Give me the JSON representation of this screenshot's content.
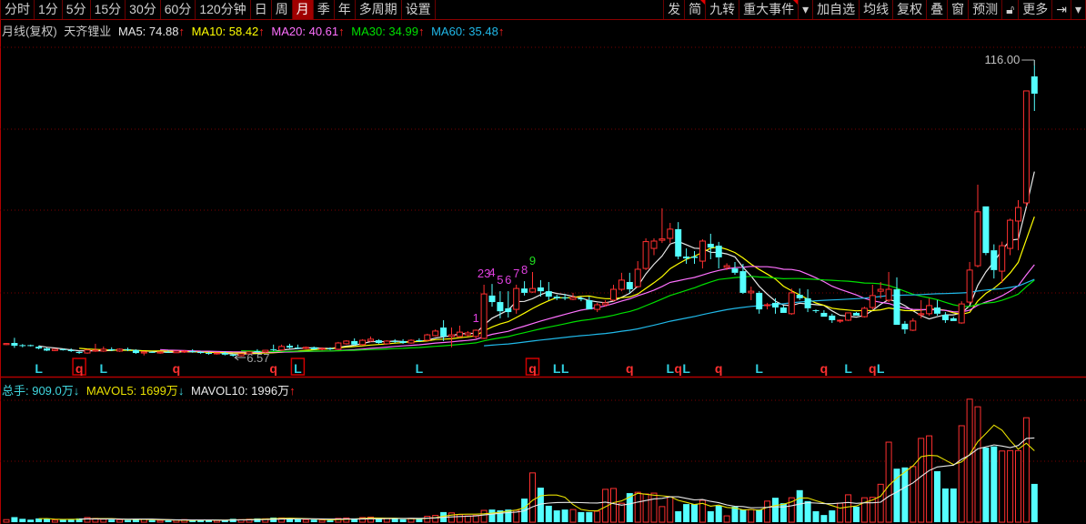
{
  "toolbar": {
    "left": [
      {
        "label": "分时"
      },
      {
        "label": "1分"
      },
      {
        "label": "5分"
      },
      {
        "label": "15分"
      },
      {
        "label": "30分"
      },
      {
        "label": "60分"
      },
      {
        "label": "120分钟"
      },
      {
        "label": "日"
      },
      {
        "label": "周"
      },
      {
        "label": "月",
        "active": true
      },
      {
        "label": "季"
      },
      {
        "label": "年"
      },
      {
        "label": "多周期"
      },
      {
        "label": "设置"
      }
    ],
    "right": [
      {
        "label": "发"
      },
      {
        "label": "简",
        "flag": true
      },
      {
        "label": "九转"
      },
      {
        "label": "重大事件",
        "flag": true
      },
      {
        "label": "▾",
        "icon": "dropdown-icon"
      },
      {
        "label": "加自选"
      },
      {
        "label": "均线"
      },
      {
        "label": "复权"
      },
      {
        "label": "叠"
      },
      {
        "label": "窗"
      },
      {
        "label": "预测"
      },
      {
        "label": "🔓︎",
        "icon": "lock-icon"
      },
      {
        "label": "更多"
      },
      {
        "label": "⇥",
        "icon": "collapse-panel-icon"
      },
      {
        "label": "▾",
        "icon": "dropdown-icon"
      }
    ]
  },
  "legend": {
    "period": "月线(复权)",
    "stock_name": "天齐锂业",
    "ma5": "MA5: 74.88",
    "ma10": "MA10: 58.42",
    "ma20": "MA20: 40.61",
    "ma30": "MA30: 34.99",
    "ma60": "MA60: 35.48",
    "up_arrow": "↑",
    "down_arrow": "↓"
  },
  "vol_legend": {
    "total": "总手: 909.0万",
    "mavol5": "MAVOL5: 1699万",
    "mavol10": "MAVOL10: 1996万"
  },
  "colors": {
    "up": "#ff3030",
    "down": "#54ffff",
    "ma5": "#e8e8e8",
    "ma10": "#ffff00",
    "ma20": "#ff70ff",
    "ma30": "#00e000",
    "ma60": "#20b8e8",
    "grid": "#7a0000",
    "border": "#b00000"
  },
  "chart_data": {
    "type": "candlestick",
    "period": "monthly",
    "annotations": {
      "high_label": "116.00",
      "low_label": "6.57"
    },
    "ohlc": [
      [
        11.0,
        11.6,
        10.8,
        11.4
      ],
      [
        11.6,
        13.5,
        9.8,
        10.6
      ],
      [
        10.8,
        11.2,
        10.0,
        10.6
      ],
      [
        10.8,
        11.0,
        10.3,
        10.5
      ],
      [
        10.2,
        10.6,
        9.3,
        9.6
      ],
      [
        9.6,
        9.9,
        8.6,
        8.8
      ],
      [
        8.8,
        9.3,
        8.6,
        9.3
      ],
      [
        9.3,
        9.6,
        8.8,
        9.0
      ],
      [
        9.0,
        9.6,
        8.3,
        8.6
      ],
      [
        8.3,
        8.6,
        7.6,
        7.9
      ],
      [
        7.9,
        9.3,
        7.6,
        9.0
      ],
      [
        8.6,
        11.3,
        8.3,
        9.0
      ],
      [
        8.6,
        10.3,
        8.3,
        9.3
      ],
      [
        9.3,
        10.0,
        8.6,
        8.9
      ],
      [
        8.6,
        9.6,
        8.3,
        9.3
      ],
      [
        9.3,
        9.9,
        8.6,
        9.0
      ],
      [
        9.0,
        9.3,
        7.6,
        7.9
      ],
      [
        7.9,
        8.6,
        7.0,
        8.3
      ],
      [
        8.3,
        8.6,
        7.9,
        8.0
      ],
      [
        7.9,
        8.6,
        7.6,
        8.3
      ],
      [
        8.3,
        8.9,
        7.9,
        8.0
      ],
      [
        8.0,
        8.6,
        7.9,
        8.6
      ],
      [
        8.3,
        9.0,
        7.9,
        8.6
      ],
      [
        8.6,
        9.3,
        8.0,
        8.3
      ],
      [
        8.3,
        8.6,
        7.6,
        7.9
      ],
      [
        7.9,
        8.3,
        7.3,
        7.6
      ],
      [
        7.6,
        8.0,
        7.3,
        7.9
      ],
      [
        7.9,
        8.6,
        7.0,
        7.3
      ],
      [
        7.3,
        7.6,
        6.57,
        6.9
      ],
      [
        6.9,
        7.6,
        6.6,
        7.6
      ],
      [
        7.6,
        8.6,
        7.3,
        8.3
      ],
      [
        8.6,
        9.3,
        8.0,
        8.3
      ],
      [
        8.3,
        9.0,
        7.9,
        8.9
      ],
      [
        9.3,
        11.0,
        8.6,
        9.0
      ],
      [
        9.0,
        11.0,
        8.6,
        10.3
      ],
      [
        10.6,
        11.3,
        9.6,
        9.9
      ],
      [
        9.9,
        11.0,
        9.3,
        9.6
      ],
      [
        9.6,
        10.3,
        9.3,
        10.0
      ],
      [
        10.0,
        10.3,
        9.0,
        9.3
      ],
      [
        9.3,
        10.0,
        8.9,
        9.6
      ],
      [
        9.6,
        10.0,
        9.0,
        9.3
      ],
      [
        9.3,
        12.0,
        9.0,
        11.6
      ],
      [
        11.3,
        12.6,
        11.0,
        12.3
      ],
      [
        12.3,
        13.3,
        10.6,
        11.0
      ],
      [
        11.0,
        13.0,
        10.6,
        12.6
      ],
      [
        12.3,
        14.0,
        12.0,
        13.0
      ],
      [
        12.6,
        13.0,
        11.3,
        11.6
      ],
      [
        11.3,
        12.6,
        11.0,
        12.3
      ],
      [
        12.3,
        13.0,
        11.6,
        12.0
      ],
      [
        12.3,
        13.0,
        11.3,
        11.6
      ],
      [
        11.6,
        13.0,
        11.3,
        12.6
      ],
      [
        12.6,
        13.3,
        12.0,
        12.3
      ],
      [
        12.6,
        15.0,
        12.3,
        14.6
      ],
      [
        14.3,
        16.6,
        14.0,
        16.0
      ],
      [
        17.3,
        20.0,
        12.3,
        14.0
      ],
      [
        14.0,
        17.3,
        10.0,
        14.6
      ],
      [
        14.0,
        18.0,
        13.6,
        15.6
      ],
      [
        14.6,
        16.0,
        14.0,
        15.3
      ],
      [
        14.0,
        16.6,
        13.3,
        16.3
      ],
      [
        13.3,
        33.1,
        13.0,
        29.7
      ],
      [
        29.1,
        33.4,
        25.0,
        26.7
      ],
      [
        26.7,
        30.7,
        20.7,
        23.3
      ],
      [
        24.4,
        30.7,
        21.0,
        23.0
      ],
      [
        24.0,
        33.1,
        22.4,
        31.7
      ],
      [
        31.7,
        34.4,
        29.1,
        30.1
      ],
      [
        30.4,
        37.8,
        30.1,
        31.7
      ],
      [
        32.1,
        34.8,
        28.7,
        30.7
      ],
      [
        30.7,
        34.1,
        27.4,
        28.7
      ],
      [
        28.7,
        29.4,
        27.4,
        28.1
      ],
      [
        28.4,
        29.7,
        27.4,
        28.1
      ],
      [
        27.7,
        30.1,
        27.4,
        28.4
      ],
      [
        28.1,
        28.7,
        27.0,
        27.7
      ],
      [
        27.4,
        28.7,
        24.0,
        24.0
      ],
      [
        24.0,
        26.4,
        23.0,
        25.7
      ],
      [
        25.7,
        27.4,
        25.0,
        26.4
      ],
      [
        27.4,
        33.1,
        27.0,
        31.4
      ],
      [
        31.4,
        37.5,
        30.7,
        34.8
      ],
      [
        34.1,
        37.5,
        30.1,
        31.4
      ],
      [
        32.4,
        41.8,
        32.0,
        38.8
      ],
      [
        39.1,
        50.2,
        38.5,
        49.0
      ],
      [
        46.5,
        50.2,
        44.0,
        49.2
      ],
      [
        49.5,
        61.3,
        48.5,
        50.0
      ],
      [
        50.2,
        55.9,
        48.5,
        53.6
      ],
      [
        53.6,
        56.2,
        42.5,
        43.5
      ],
      [
        43.5,
        46.5,
        40.8,
        42.8
      ],
      [
        43.5,
        45.5,
        40.8,
        43.0
      ],
      [
        41.8,
        49.9,
        39.1,
        49.2
      ],
      [
        48.2,
        51.9,
        42.5,
        46.8
      ],
      [
        47.5,
        48.9,
        39.1,
        43.2
      ],
      [
        39.5,
        41.0,
        38.5,
        40.1
      ],
      [
        39.1,
        41.5,
        36.8,
        37.5
      ],
      [
        38.1,
        40.8,
        29.7,
        30.1
      ],
      [
        30.1,
        32.4,
        27.4,
        30.7
      ],
      [
        30.1,
        30.7,
        22.4,
        24.0
      ],
      [
        25.4,
        26.4,
        24.0,
        25.7
      ],
      [
        26.4,
        28.1,
        22.4,
        24.7
      ],
      [
        24.7,
        25.4,
        22.7,
        22.7
      ],
      [
        22.4,
        31.7,
        22.0,
        30.1
      ],
      [
        29.4,
        31.7,
        27.4,
        28.1
      ],
      [
        28.1,
        31.4,
        23.0,
        24.4
      ],
      [
        23.7,
        24.0,
        22.7,
        23.4
      ],
      [
        22.7,
        23.7,
        21.3,
        21.3
      ],
      [
        21.7,
        22.4,
        19.0,
        20.0
      ],
      [
        20.0,
        20.3,
        19.0,
        20.0
      ],
      [
        20.0,
        22.7,
        19.7,
        22.7
      ],
      [
        22.7,
        23.0,
        21.7,
        21.7
      ],
      [
        21.3,
        25.0,
        21.0,
        24.4
      ],
      [
        24.7,
        33.1,
        24.0,
        29.1
      ],
      [
        30.7,
        34.1,
        28.0,
        31.4
      ],
      [
        27.4,
        37.8,
        26.7,
        31.4
      ],
      [
        31.4,
        35.8,
        18.3,
        18.3
      ],
      [
        18.7,
        19.7,
        15.0,
        16.6
      ],
      [
        16.3,
        20.7,
        16.0,
        19.7
      ],
      [
        22.0,
        27.4,
        20.7,
        22.4
      ],
      [
        22.4,
        28.0,
        21.7,
        25.4
      ],
      [
        24.7,
        27.4,
        21.7,
        22.4
      ],
      [
        22.0,
        23.0,
        19.0,
        20.0
      ],
      [
        20.7,
        21.3,
        19.7,
        19.7
      ],
      [
        19.0,
        27.0,
        18.7,
        26.0
      ],
      [
        26.7,
        41.5,
        26.0,
        38.5
      ],
      [
        40.1,
        70.0,
        39.5,
        60.0
      ],
      [
        62.0,
        62.0,
        44.0,
        44.8
      ],
      [
        45.8,
        48.0,
        35.4,
        38.5
      ],
      [
        38.1,
        49.0,
        33.8,
        47.5
      ],
      [
        46.5,
        57.5,
        44.0,
        56.9
      ],
      [
        56.6,
        64.3,
        45.8,
        61.6
      ],
      [
        63.3,
        104.6,
        62.0,
        104.6
      ],
      [
        109.96,
        116.0,
        97.2,
        103.6
      ]
    ],
    "volume_wan": [
      60,
      120,
      80,
      60,
      90,
      80,
      50,
      60,
      70,
      90,
      110,
      90,
      70,
      60,
      60,
      50,
      80,
      70,
      50,
      40,
      40,
      50,
      60,
      40,
      60,
      50,
      40,
      50,
      80,
      60,
      70,
      90,
      80,
      110,
      100,
      90,
      70,
      60,
      60,
      50,
      50,
      90,
      100,
      90,
      110,
      120,
      80,
      90,
      80,
      70,
      90,
      80,
      140,
      160,
      240,
      220,
      180,
      150,
      160,
      280,
      300,
      280,
      300,
      280,
      560,
      1170,
      820,
      390,
      280,
      300,
      300,
      240,
      240,
      260,
      780,
      800,
      450,
      690,
      710,
      670,
      690,
      370,
      600,
      260,
      430,
      430,
      520,
      260,
      390,
      150,
      370,
      300,
      300,
      300,
      500,
      580,
      450,
      580,
      760,
      500,
      260,
      170,
      280,
      450,
      650,
      370,
      580,
      590,
      900,
      1900,
      1270,
      1300,
      1320,
      1990,
      2050,
      1210,
      800,
      800,
      2290,
      2920,
      2740,
      1770,
      1800,
      1690,
      1700,
      1700,
      2480,
      909
    ],
    "signals": [
      {
        "i": 4,
        "t": "L"
      },
      {
        "i": 9,
        "t": "q",
        "boxed": true
      },
      {
        "i": 12,
        "t": "L"
      },
      {
        "i": 21,
        "t": "q"
      },
      {
        "i": 33,
        "t": "q"
      },
      {
        "i": 36,
        "t": "L",
        "boxed": true
      },
      {
        "i": 51,
        "t": "L"
      },
      {
        "i": 65,
        "t": "q",
        "boxed": true
      },
      {
        "i": 68,
        "t": "L"
      },
      {
        "i": 69,
        "t": "L"
      },
      {
        "i": 77,
        "t": "q"
      },
      {
        "i": 82,
        "t": "L"
      },
      {
        "i": 83,
        "t": "q"
      },
      {
        "i": 84,
        "t": "L"
      },
      {
        "i": 88,
        "t": "q"
      },
      {
        "i": 93,
        "t": "L"
      },
      {
        "i": 101,
        "t": "q"
      },
      {
        "i": 104,
        "t": "L"
      },
      {
        "i": 107,
        "t": "q"
      },
      {
        "i": 108,
        "t": "L"
      }
    ],
    "nine_turn": [
      {
        "i": 58,
        "t": "1"
      },
      {
        "i": 59,
        "t": "23"
      },
      {
        "i": 60,
        "t": "4"
      },
      {
        "i": 61,
        "t": "5"
      },
      {
        "i": 62,
        "t": "6"
      },
      {
        "i": 63,
        "t": "7"
      },
      {
        "i": 64,
        "t": "8"
      },
      {
        "i": 65,
        "t": "9",
        "color": "#20e020"
      }
    ],
    "nine_turn_color": "#e040e0",
    "signal_colors": {
      "L": "#30d0e0",
      "q": "#ff3030"
    },
    "ma_periods": [
      5,
      10,
      20,
      30,
      60
    ],
    "mavol_periods": [
      5,
      10
    ]
  }
}
